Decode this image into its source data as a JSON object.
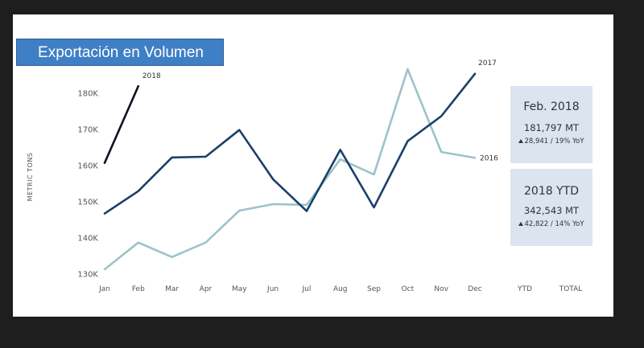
{
  "title": "Exportación en Volumen",
  "chart_data": {
    "type": "line",
    "ylabel": "METRIC TONS",
    "xlabel": "",
    "ylim": [
      129000,
      184500
    ],
    "yticks": [
      130000,
      140000,
      150000,
      160000,
      170000,
      180000
    ],
    "ytick_labels": [
      "130K",
      "140K",
      "150K",
      "160K",
      "170K",
      "180K"
    ],
    "categories": [
      "Jan",
      "Feb",
      "Mar",
      "Apr",
      "May",
      "Jun",
      "Jul",
      "Aug",
      "Sep",
      "Oct",
      "Nov",
      "Dec"
    ],
    "extra_columns": [
      "YTD",
      "TOTAL"
    ],
    "grid": false,
    "legend": "inline end labels",
    "series": [
      {
        "name": "2016",
        "color": "#9cc3c9",
        "values": [
          131200,
          138600,
          134600,
          138600,
          147400,
          149200,
          149000,
          161600,
          157400,
          186500,
          163600,
          162000
        ]
      },
      {
        "name": "2017",
        "color": "#1a3f6a",
        "values": [
          146600,
          152800,
          162100,
          162300,
          169700,
          156100,
          147300,
          164200,
          148300,
          166600,
          173500,
          185200
        ]
      },
      {
        "name": "2018",
        "color": "#111122",
        "values": [
          160600,
          181797
        ]
      }
    ]
  },
  "panels": {
    "month": {
      "title": "Feb. 2018",
      "value": "181,797 MT",
      "delta": "28,941 / 19% YoY"
    },
    "ytd": {
      "title": "2018 YTD",
      "value": "342,543 MT",
      "delta": "42,822 / 14% YoY"
    }
  }
}
